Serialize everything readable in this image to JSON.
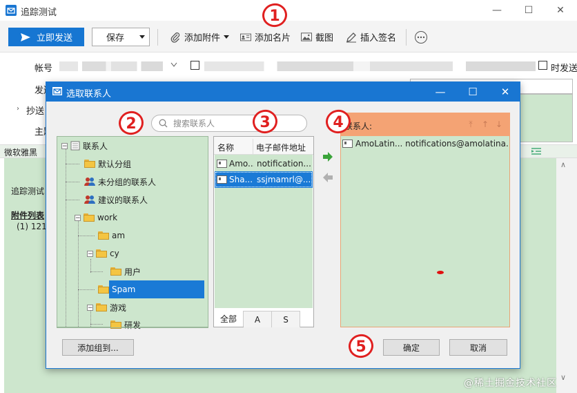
{
  "window": {
    "title": "追踪测试",
    "controls": [
      "—",
      "☐",
      "✕"
    ]
  },
  "toolbar": {
    "send_label": "立即发送",
    "save_label": "保存",
    "attach_label": "添加附件",
    "card_label": "添加名片",
    "screenshot_label": "截图",
    "signature_label": "插入签名"
  },
  "compose": {
    "account_label": "帐号",
    "from_label": "发送",
    "cc_label": "抄送",
    "subject_label": "主题",
    "send_right": "时发送",
    "antispam_label": "微软雅黑",
    "body_text": "追踪测试",
    "attach_list_label": "附件列表",
    "attach_item": "(1) 121."
  },
  "dialog": {
    "title": "选取联系人",
    "search_placeholder": "搜索联系人",
    "tree": [
      {
        "label": "联系人"
      },
      {
        "label": "默认分组"
      },
      {
        "label": "未分组的联系人"
      },
      {
        "label": "建议的联系人"
      },
      {
        "label": "work"
      },
      {
        "label": "am"
      },
      {
        "label": "cy"
      },
      {
        "label": "用户"
      },
      {
        "label": "Spam"
      },
      {
        "label": "游戏"
      },
      {
        "label": "研发"
      }
    ],
    "list_headers": [
      "名称",
      "电子邮件地址"
    ],
    "list_rows": [
      {
        "name": "Amo...",
        "email": "notification..."
      },
      {
        "name": "Sha...",
        "email": "ssjmamrl@..."
      }
    ],
    "list_tabs": [
      "全部",
      "A",
      "S"
    ],
    "recipients_label": "联系人:",
    "recipient_row": "AmoLatin... notifications@amolatina....",
    "add_group_button": "添加组到...",
    "ok_button": "确定",
    "cancel_button": "取消"
  },
  "annotations": [
    "1",
    "2",
    "3",
    "4",
    "5"
  ],
  "watermark": "@稀土掘金技术社区",
  "colors": {
    "accent": "#1976d2",
    "panel_green": "#cde6cd",
    "recipient_header": "#f4a374",
    "selection": "#1a7ad6",
    "annotation_red": "#e02020"
  }
}
